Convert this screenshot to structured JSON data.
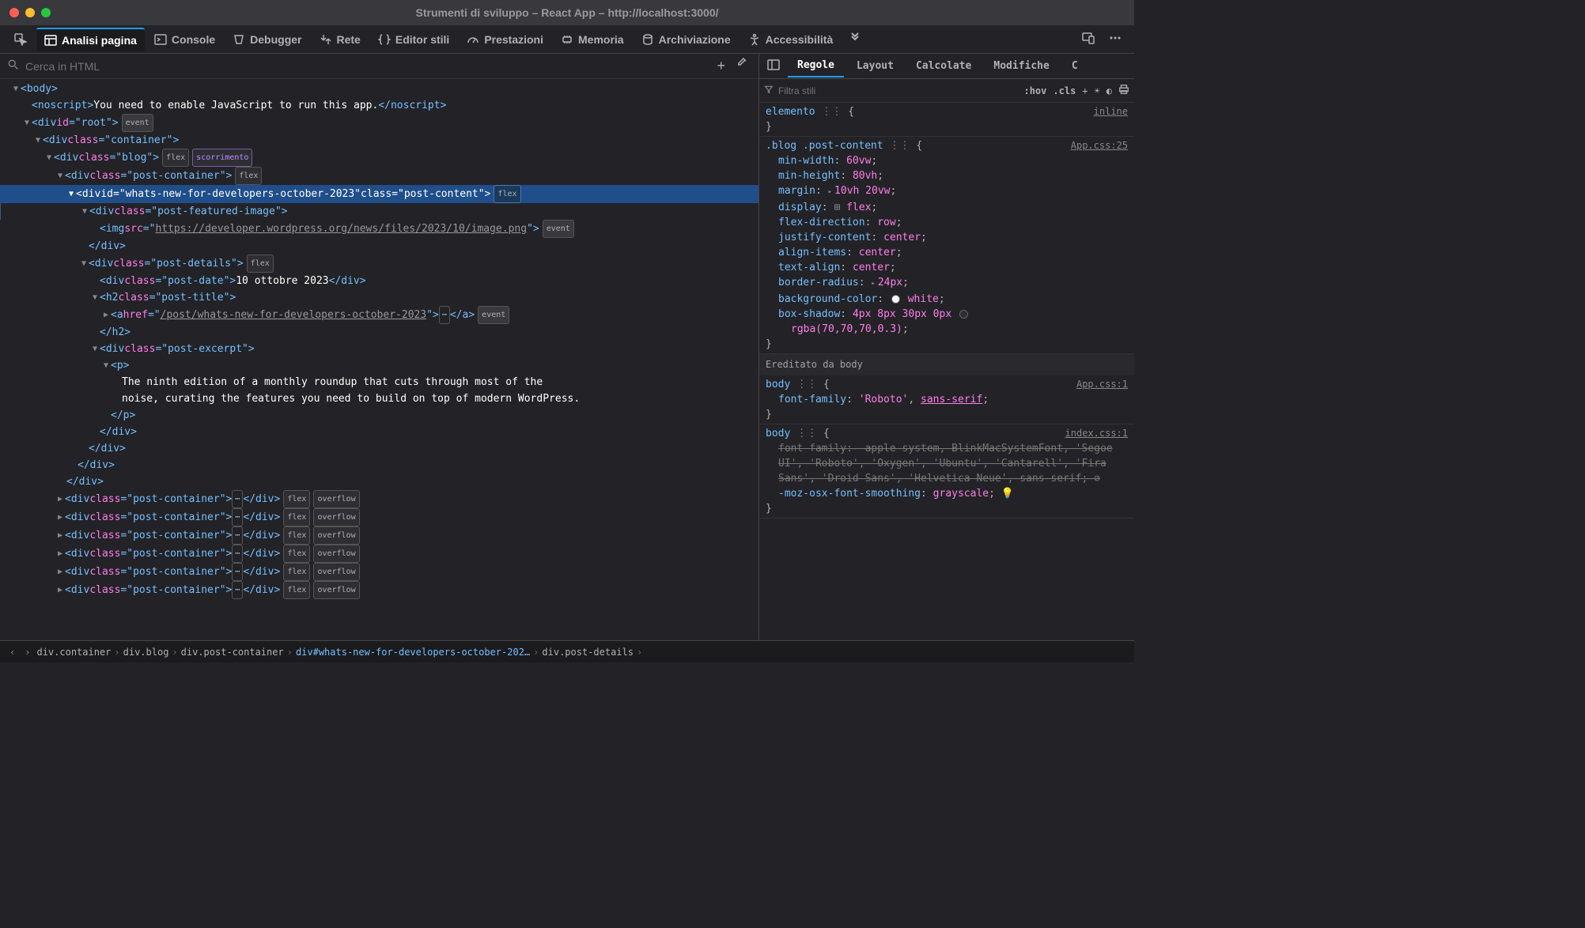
{
  "window": {
    "title": "Strumenti di sviluppo – React App – http://localhost:3000/"
  },
  "toolbar": {
    "inspector": "Analisi pagina",
    "console": "Console",
    "debugger": "Debugger",
    "network": "Rete",
    "style_editor": "Editor stili",
    "performance": "Prestazioni",
    "memory": "Memoria",
    "storage": "Archiviazione",
    "accessibility": "Accessibilità"
  },
  "search": {
    "placeholder": "Cerca in HTML"
  },
  "dom": {
    "body_tag": "body",
    "noscript_open": "<noscript>",
    "noscript_text": "You need to enable JavaScript to run this app.",
    "noscript_close": "</noscript>",
    "root_id": "root",
    "container_class": "container",
    "blog_class": "blog",
    "post_container_class": "post-container",
    "selected_id": "whats-new-for-developers-october-2023",
    "selected_class": "post-content",
    "featured_image_class": "post-featured-image",
    "img_src": "https://developer.wordpress.org/news/files/2023/10/image.png",
    "post_details_class": "post-details",
    "post_date_class": "post-date",
    "post_date_text": "10 ottobre 2023",
    "post_title_class": "post-title",
    "post_link_href": "/post/whats-new-for-developers-october-2023",
    "post_excerpt_class": "post-excerpt",
    "excerpt_text": "The ninth edition of a monthly roundup that cuts through most of the noise, curating the features you need to build on top of modern WordPress.",
    "badge_event": "event",
    "badge_flex": "flex",
    "badge_scroll": "scorrimento",
    "badge_overflow": "overflow"
  },
  "right_tabs": {
    "rules": "Regole",
    "layout": "Layout",
    "computed": "Calcolate",
    "changes": "Modifiche",
    "more": "C"
  },
  "filter": {
    "placeholder": "Filtra stili",
    "hov": ":hov",
    "cls": ".cls"
  },
  "rules": {
    "element_label": "elemento",
    "inline": "inline",
    "selector1": ".blog .post-content",
    "source1": "App.css:25",
    "props1": {
      "min-width": "60vw",
      "min-height": "80vh",
      "margin": "10vh 20vw",
      "display": "flex",
      "flex-direction": "row",
      "justify-content": "center",
      "align-items": "center",
      "text-align": "center",
      "border-radius": "24px",
      "background-color": "white",
      "box-shadow": "4px 8px 30px 0px rgba(70,70,70,0.3)"
    },
    "inherited_from": "Ereditato da body",
    "body_sel": "body",
    "source2": "App.css:1",
    "font_family_app": "'Roboto', sans-serif",
    "source3": "index.css:1",
    "font_family_idx": "-apple-system, BlinkMacSystemFont, 'Segoe UI', 'Roboto', 'Oxygen', 'Ubuntu', 'Cantarell', 'Fira Sans', 'Droid Sans', 'Helvetica Neue', sans-serif",
    "moz_prop": "-moz-osx-font-smoothing",
    "moz_val": "grayscale"
  },
  "breadcrumb": {
    "c1": "div.container",
    "c2": "div.blog",
    "c3": "div.post-container",
    "c4": "div#whats-new-for-developers-october-202…",
    "c5": "div.post-details"
  }
}
